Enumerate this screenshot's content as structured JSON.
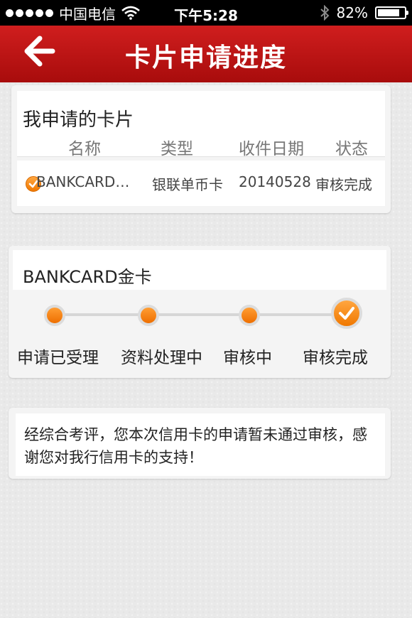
{
  "status_bar": {
    "carrier": "中国电信",
    "time": "下午5:28",
    "battery": "82%",
    "battery_level": 0.82
  },
  "nav": {
    "title": "卡片申请进度",
    "back_icon": "arrow-left-icon"
  },
  "my_cards": {
    "title": "我申请的卡片",
    "columns": [
      "名称",
      "类型",
      "收件日期",
      "状态"
    ],
    "rows": [
      {
        "name": "BANKCARD…",
        "type": "银联单币卡",
        "date": "20140528",
        "status": "审核完成",
        "icon": "check-circle-icon"
      }
    ]
  },
  "progress": {
    "card_name": "BANKCARD金卡",
    "steps": [
      "申请已受理",
      "资料处理中",
      "审核中",
      "审核完成"
    ],
    "current_step": 4
  },
  "message": {
    "text": "经综合考评，您本次信用卡的申请暂未通过审核，感谢您对我行信用卡的支持！"
  },
  "colors": {
    "nav_red": "#c01414",
    "accent_orange": "#f28a1c"
  }
}
